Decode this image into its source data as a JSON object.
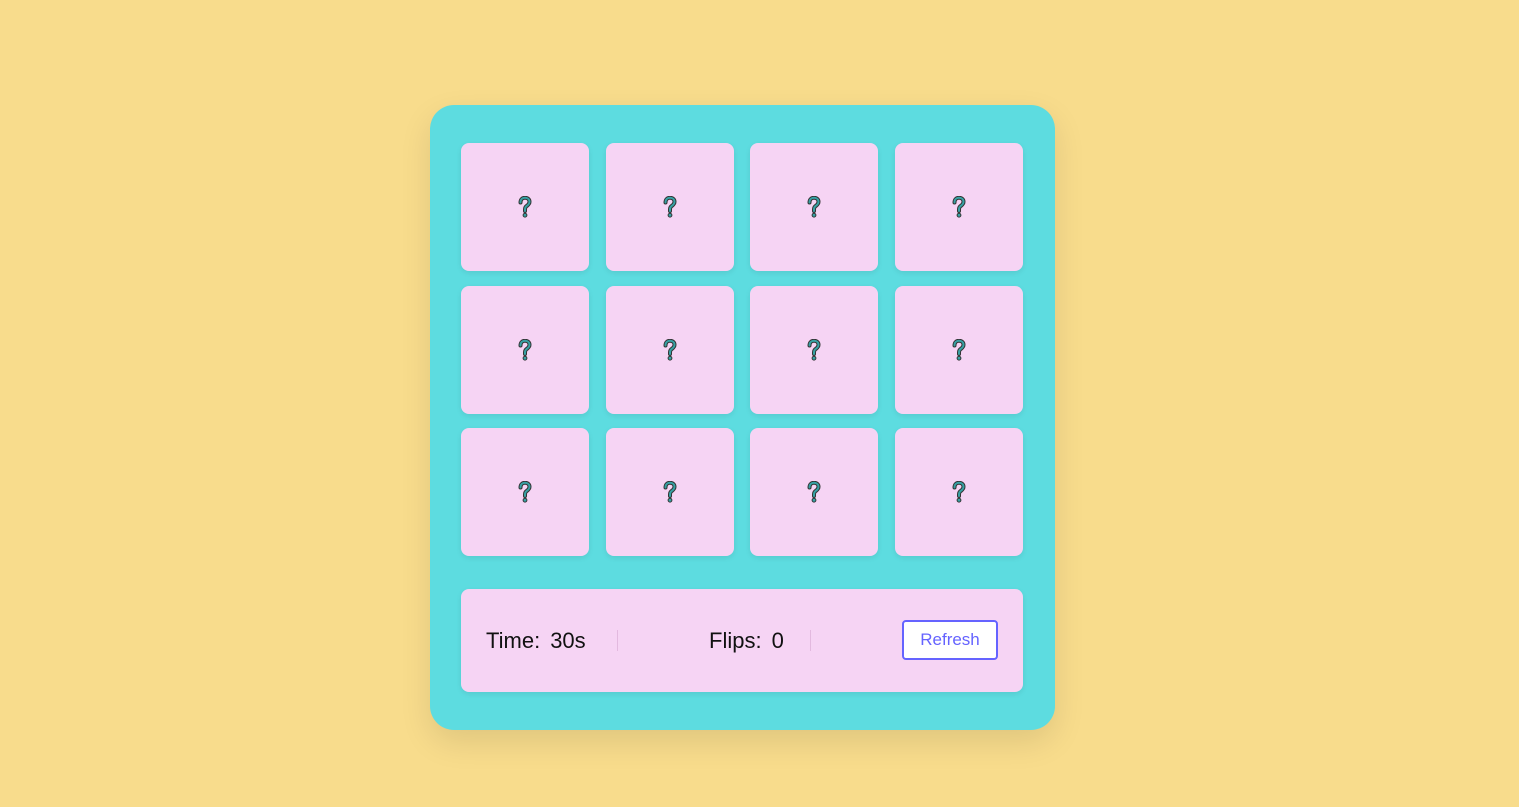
{
  "theme": {
    "background": "#f8dc8c",
    "board": "#5ddce0",
    "card": "#f6d4f4",
    "question_mark": "#37a1a4",
    "accent": "#6563ff"
  },
  "cards": [
    {
      "face": "?",
      "icon": "question-mark-icon"
    },
    {
      "face": "?",
      "icon": "question-mark-icon"
    },
    {
      "face": "?",
      "icon": "question-mark-icon"
    },
    {
      "face": "?",
      "icon": "question-mark-icon"
    },
    {
      "face": "?",
      "icon": "question-mark-icon"
    },
    {
      "face": "?",
      "icon": "question-mark-icon"
    },
    {
      "face": "?",
      "icon": "question-mark-icon"
    },
    {
      "face": "?",
      "icon": "question-mark-icon"
    },
    {
      "face": "?",
      "icon": "question-mark-icon"
    },
    {
      "face": "?",
      "icon": "question-mark-icon"
    },
    {
      "face": "?",
      "icon": "question-mark-icon"
    },
    {
      "face": "?",
      "icon": "question-mark-icon"
    }
  ],
  "details": {
    "time_label": "Time:",
    "time_value": "30s",
    "flips_label": "Flips:",
    "flips_value": "0",
    "refresh_label": "Refresh"
  }
}
